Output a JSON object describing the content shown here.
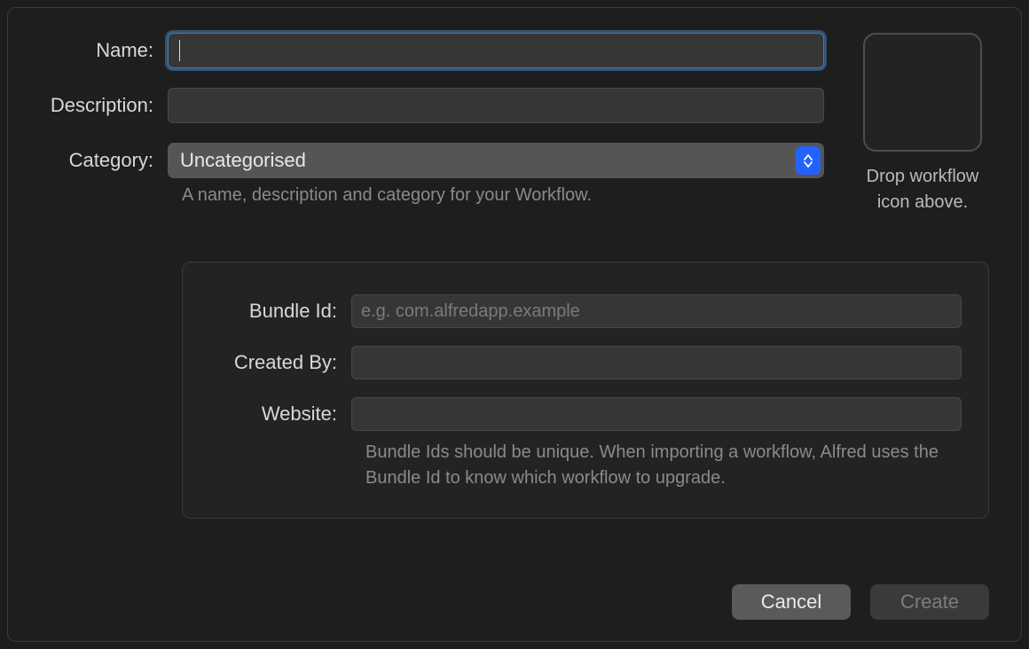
{
  "labels": {
    "name": "Name:",
    "description": "Description:",
    "category": "Category:",
    "bundle_id": "Bundle Id:",
    "created_by": "Created By:",
    "website": "Website:"
  },
  "values": {
    "name": "",
    "description": "",
    "category": "Uncategorised",
    "bundle_id": "",
    "created_by": "",
    "website": ""
  },
  "placeholders": {
    "bundle_id": "e.g. com.alfredapp.example"
  },
  "helpers": {
    "top": "A name, description and category for your Workflow.",
    "bottom": "Bundle Ids should be unique. When importing a workflow, Alfred uses the Bundle Id to know which workflow to upgrade."
  },
  "icon_drop": {
    "line1": "Drop workflow",
    "line2": "icon above."
  },
  "buttons": {
    "cancel": "Cancel",
    "create": "Create"
  }
}
